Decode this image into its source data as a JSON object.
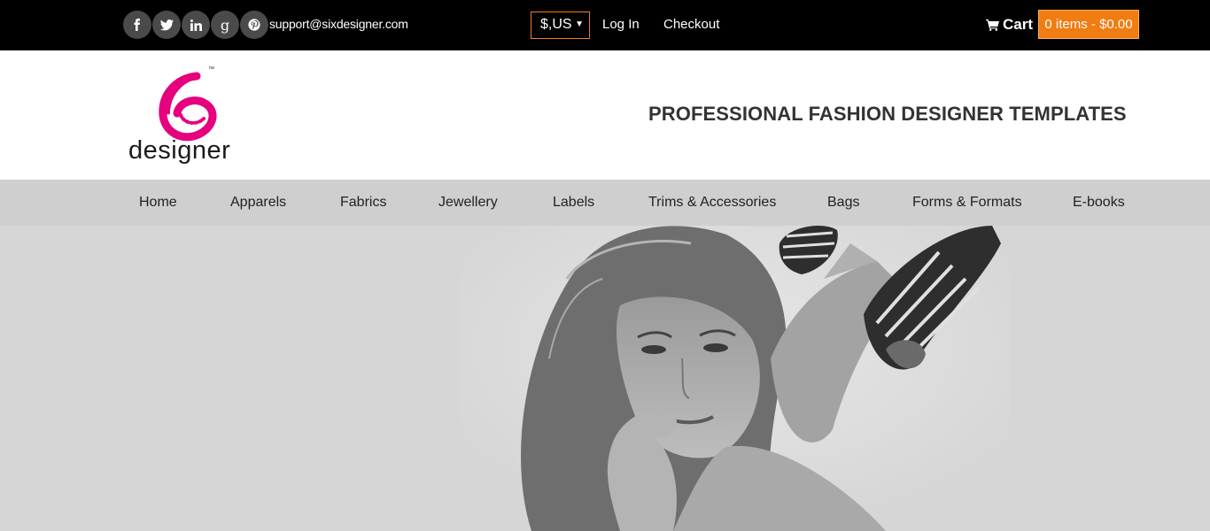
{
  "topbar": {
    "social": [
      {
        "icon": "facebook-icon",
        "glyph": "f"
      },
      {
        "icon": "twitter-icon",
        "glyph": "t"
      },
      {
        "icon": "linkedin-icon",
        "glyph": "in"
      },
      {
        "icon": "google-plus-icon",
        "glyph": "g"
      },
      {
        "icon": "pinterest-icon",
        "glyph": "p"
      }
    ],
    "email": "support@sixdesigner.com",
    "currency": "$,US",
    "login": "Log In",
    "checkout": "Checkout",
    "cart_label": "Cart",
    "cart_summary": "0 items - $0.00"
  },
  "header": {
    "logo_text": "designer",
    "logo_tm": "™",
    "tagline": "PROFESSIONAL FASHION DESIGNER TEMPLATES"
  },
  "nav": {
    "items": [
      "Home",
      "Apparels",
      "Fabrics",
      "Jewellery",
      "Labels",
      "Trims & Accessories",
      "Bags",
      "Forms & Formats",
      "E-books"
    ]
  },
  "colors": {
    "accent": "#f07c12",
    "logo_pink": "#e6007e",
    "nav_bg": "#cfcfcf",
    "topbar_bg": "#000000"
  }
}
